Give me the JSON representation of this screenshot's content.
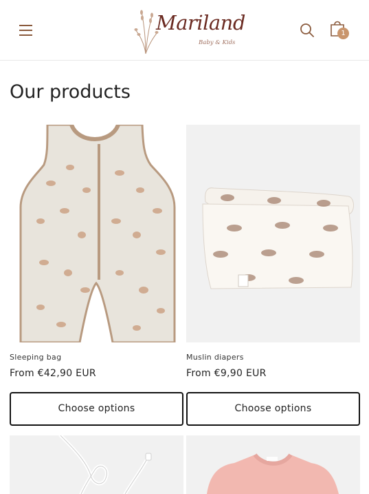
{
  "header": {
    "logo_main": "Mariland",
    "logo_sub": "Baby & Kids",
    "cart_count": "1",
    "icons": {
      "menu": "hamburger-menu-icon",
      "search": "search-icon",
      "cart": "shopping-bag-icon"
    },
    "accent_color": "#8a5a3c"
  },
  "page": {
    "title": "Our products"
  },
  "products": [
    {
      "name": "Sleeping bag",
      "price": "From €42,90 EUR",
      "button": "Choose options"
    },
    {
      "name": "Muslin diapers",
      "price": "From €9,90 EUR",
      "button": "Choose options"
    },
    {
      "name": "",
      "price": "",
      "button": ""
    },
    {
      "name": "",
      "price": "",
      "button": ""
    }
  ]
}
